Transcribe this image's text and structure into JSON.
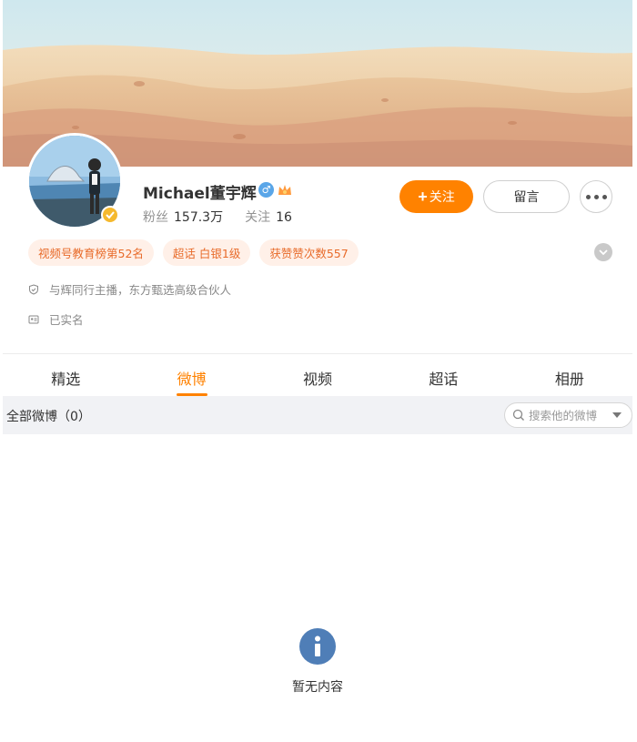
{
  "profile": {
    "name": "Michael董宇辉",
    "followers_label": "粉丝",
    "followers_value": "157.3万",
    "following_label": "关注",
    "following_value": "16"
  },
  "actions": {
    "follow_label": "关注",
    "follow_plus": "+",
    "message_label": "留言"
  },
  "tags": [
    "视频号教育榜第52名",
    "超话 白银1级",
    "获赞赞次数557"
  ],
  "info": {
    "bio": "与辉同行主播，东方甄选高级合伙人",
    "verification": "已实名"
  },
  "tabs": [
    "精选",
    "微博",
    "视频",
    "超话",
    "相册"
  ],
  "active_tab": "微博",
  "filter": {
    "title": "全部微博（0）",
    "search_placeholder": "搜索他的微博"
  },
  "empty_state": {
    "text": "暂无内容"
  },
  "colors": {
    "accent": "#ff8200",
    "tag_bg": "#fff0e8",
    "tag_text": "#e86b2a",
    "info_icon": "#4f7eb7"
  },
  "icons": [
    "gender-male-icon",
    "vip-crown-icon",
    "verified-icon",
    "more-icon",
    "chevron-down-icon",
    "shield-icon",
    "id-card-icon",
    "search-icon",
    "info-icon"
  ]
}
